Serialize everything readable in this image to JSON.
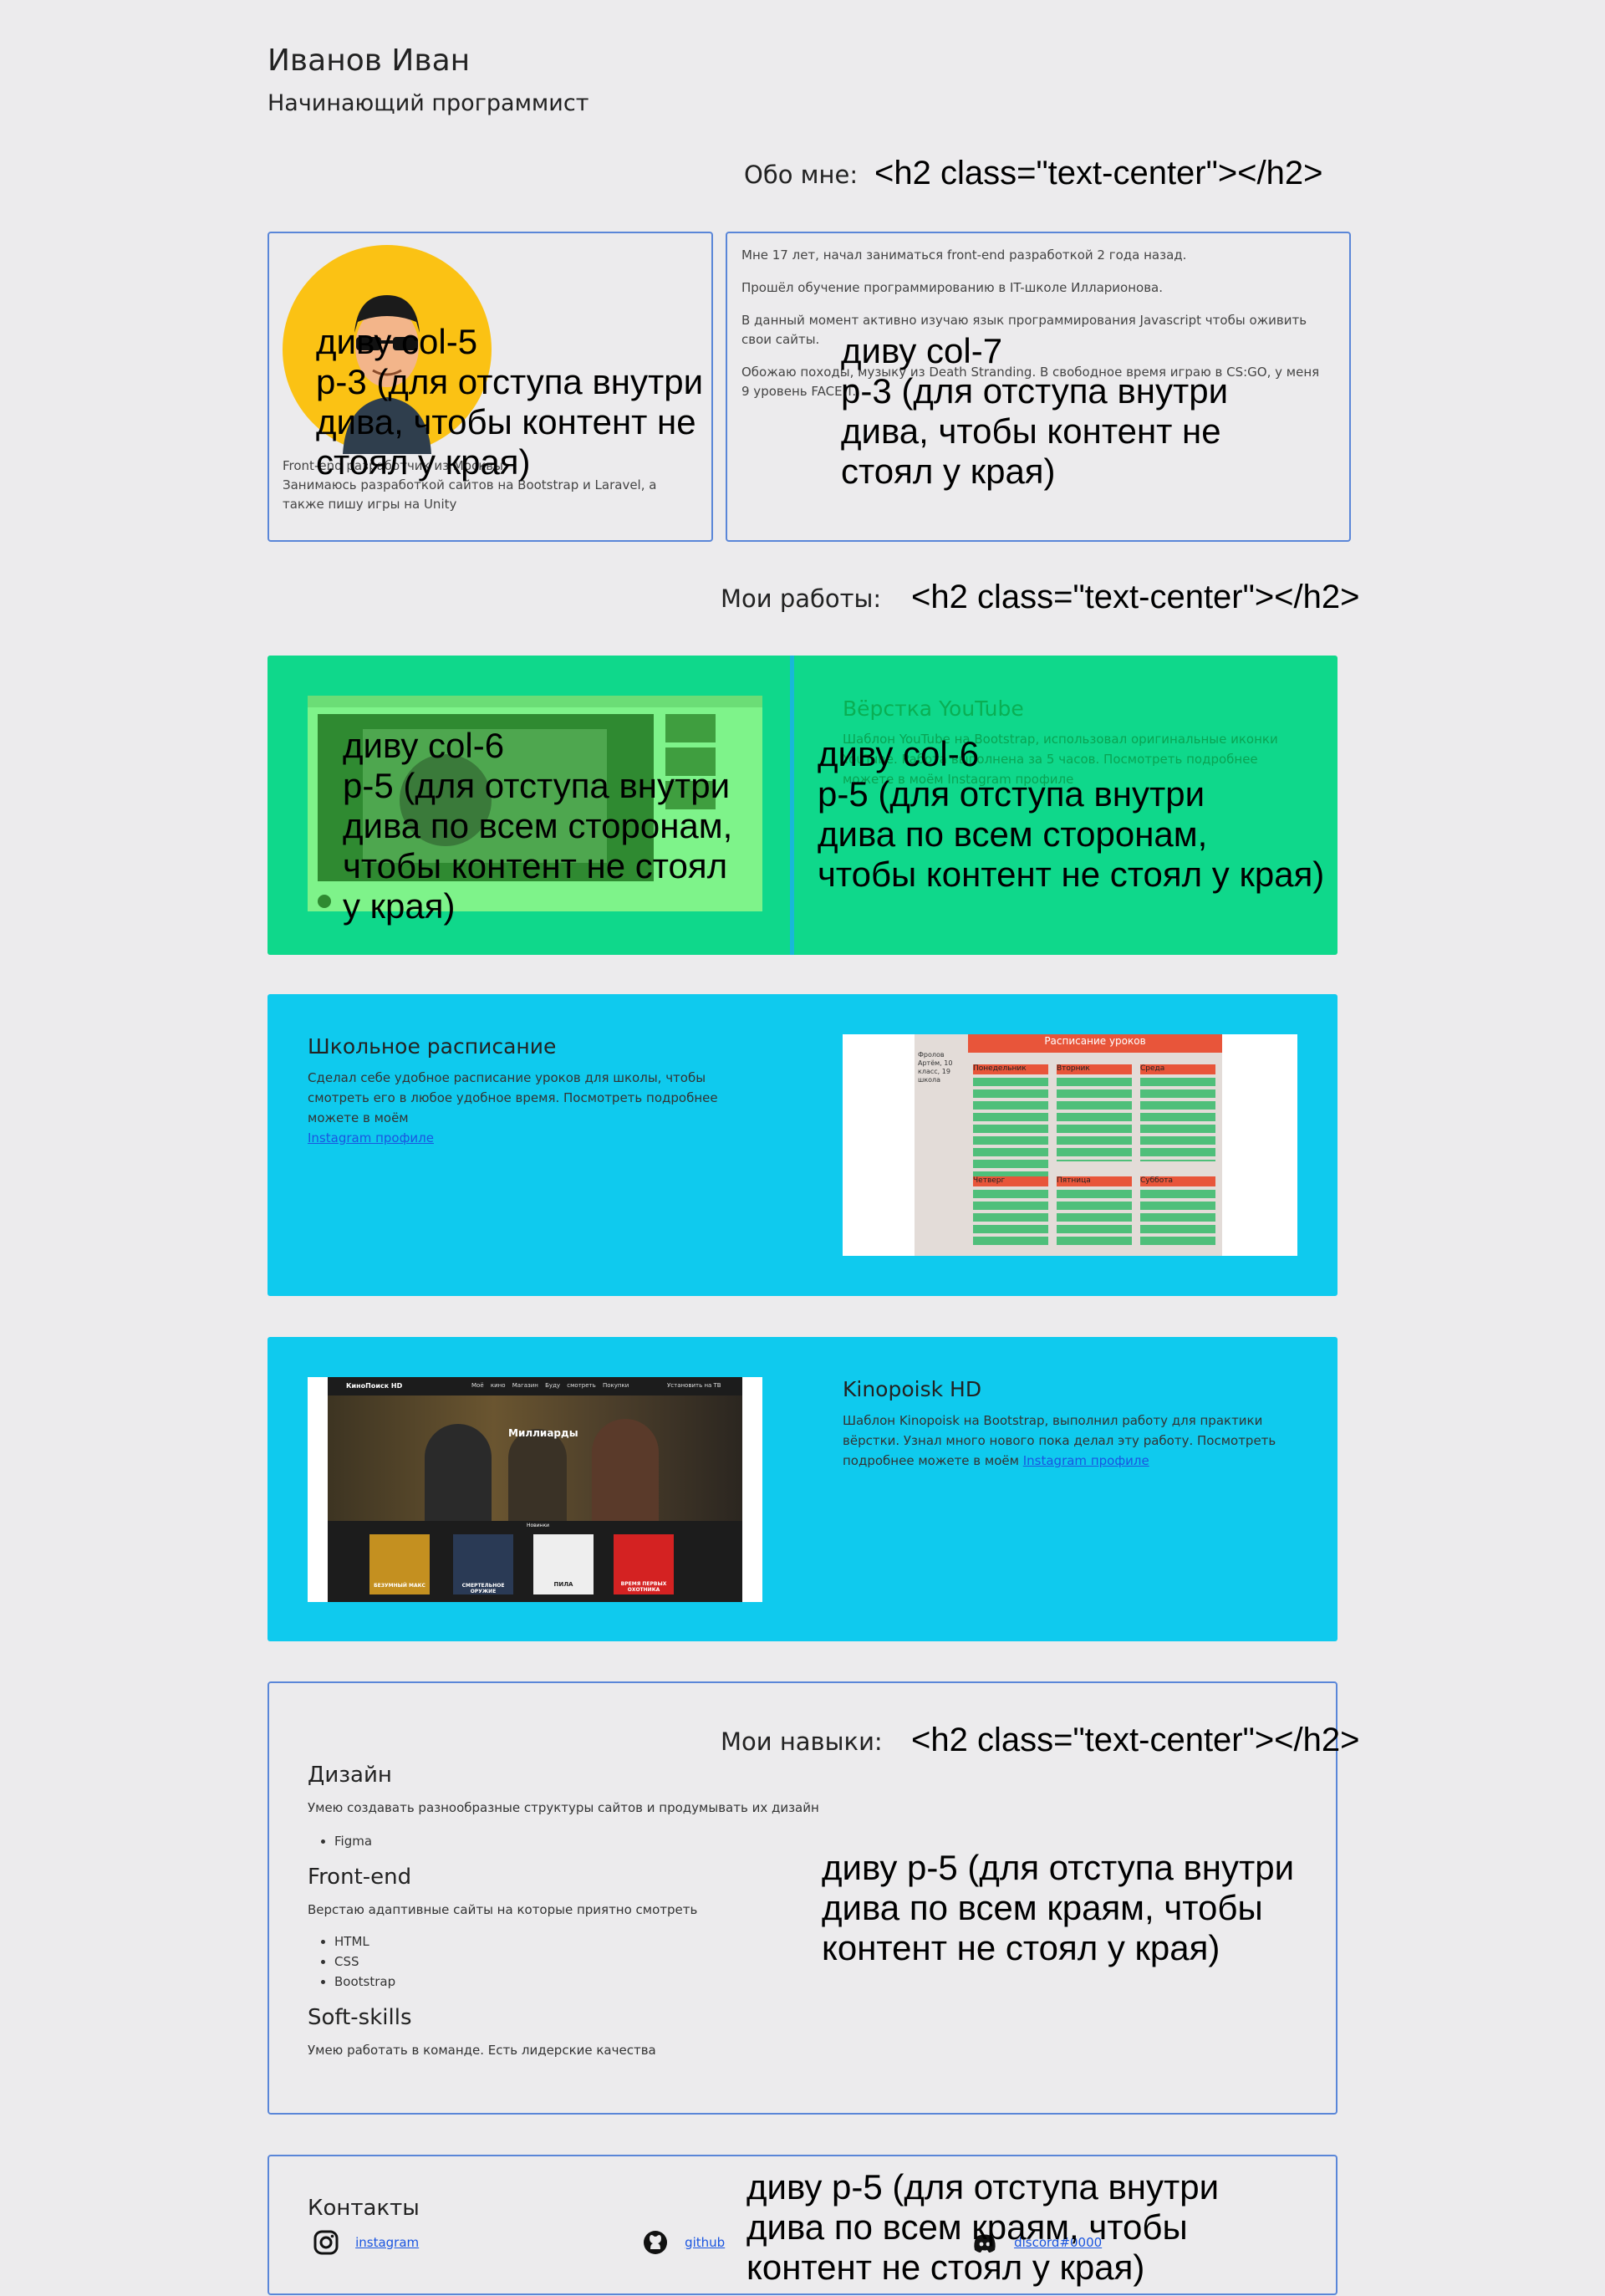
{
  "header": {
    "name": "Иванов Иван",
    "role": "Начинающий программист"
  },
  "about": {
    "heading": "Обо мне:",
    "heading_note": "<h2 class=\"text-center\"></h2>",
    "left_caption": "Front-end разработчик из Москвы",
    "left_text": "Занимаюсь разработкой сайтов на Bootstrap и Laravel, а также пишу игры на Unity",
    "paragraphs": [
      "Мне 17 лет, начал заниматься front-end разработкой 2 года назад.",
      "Прошёл обучение программированию в IT-школе Илларионова.",
      "В данный момент активно изучаю язык программирования Javascript чтобы оживить свои сайты.",
      "Обожаю походы, музыку из Death Stranding. В свободное время играю в CS:GO, у меня 9 уровень FACEIT."
    ],
    "note_left": "диву col-5\np-3 (для отступа внутри\nдива, чтобы контент не\nстоял у края)",
    "note_right": "диву col-7\np-3 (для отступа внутри\nдива, чтобы контент не\nстоял у края)"
  },
  "works": {
    "heading": "Мои работы:",
    "heading_note": "<h2 class=\"text-center\"></h2>",
    "youtube": {
      "title": "Вёрстка YouTube",
      "desc": "Шаблон YouTube на Bootstrap, использовал оригинальные иконки YouTube. Работа выполнена за 5 часов. Посмотреть подробнее можете в моём Instagram профиле",
      "note_left": "диву col-6\np-5 (для отступа внутри\nдива по всем сторонам,\nчтобы контент не стоял\n у края)",
      "note_right": "диву col-6\np-5 (для отступа внутри\nдива по всем сторонам,\nчтобы контент не стоял у края)"
    },
    "school": {
      "title": "Школьное расписание",
      "desc": "Сделал себе удобное расписание уроков для школы, чтобы смотреть его в любое удобное время. Посмотреть подробнее можете в моём",
      "link": "Instagram профиле",
      "shot_title": "Расписание уроков",
      "shot_side": "Фролов Артём, 10 класс, 19 школа",
      "days": [
        "Понедельник",
        "Вторник",
        "Среда",
        "Четверг",
        "Пятница",
        "Суббота"
      ]
    },
    "kino": {
      "title": "Kinopoisk HD",
      "desc": "Шаблон Kinopoisk на Bootstrap, выполнил работу для практики вёрстки. Узнал много нового пока делал эту работу. Посмотреть подробнее можете в моём",
      "link": "Instagram профиле",
      "shot_logo": "КиноПоиск HD",
      "shot_nav": [
        "Моё кино",
        "Магазин",
        "Буду смотреть",
        "Покупки"
      ],
      "shot_install": "Установить на ТВ",
      "shot_hero": "Миллиарды",
      "shot_section": "Новинки",
      "posters": [
        "БЕЗУМНЫЙ МАКС",
        "СМЕРТЕЛЬНОЕ ОРУЖИЕ",
        "ПИЛА",
        "ВРЕМЯ ПЕРВЫХ ОХОТНИКА"
      ]
    }
  },
  "skills": {
    "heading": "Мои навыки:",
    "heading_note": "<h2 class=\"text-center\"></h2>",
    "design": {
      "title": "Дизайн",
      "desc": "Умею создавать разнообразные структуры сайтов и продумывать их дизайн",
      "items": [
        "Figma"
      ]
    },
    "frontend": {
      "title": "Front-end",
      "desc": "Верстаю адаптивные сайты на которые приятно смотреть",
      "items": [
        "HTML",
        "CSS",
        "Bootstrap"
      ]
    },
    "soft": {
      "title": "Soft-skills",
      "desc": "Умею работать в команде. Есть лидерские качества"
    },
    "note": "диву p-5 (для отступа внутри\nдива по всем краям, чтобы\nконтент не стоял у края)"
  },
  "contacts": {
    "heading": "Контакты",
    "instagram": "instagram",
    "github": "github",
    "discord": "discord#0000",
    "note": "диву p-5 (для отступа внутри\nдива по всем краям, чтобы\nконтент не стоял у края)"
  },
  "colors": {
    "bg": "#ecebed",
    "green": "#0fd88b",
    "cyan": "#0fcaee",
    "border": "#5a86d8",
    "link": "#1a55e0"
  }
}
